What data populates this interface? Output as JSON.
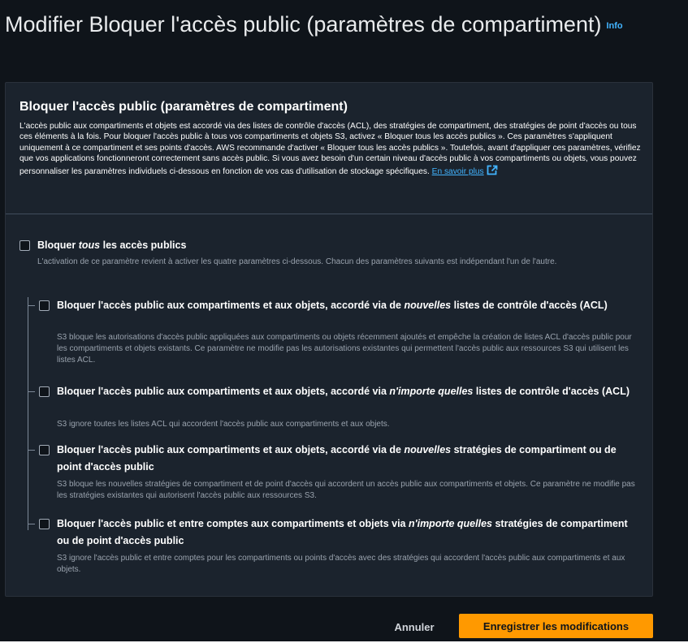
{
  "header": {
    "title": "Modifier Bloquer l'accès public (paramètres de compartiment)",
    "info_label": "Info"
  },
  "panel": {
    "title": "Bloquer l'accès public (paramètres de compartiment)",
    "description": "L'accès public aux compartiments et objets est accordé via des listes de contrôle d'accès (ACL), des stratégies de compartiment, des stratégies de point d'accès ou tous ces éléments à la fois. Pour bloquer l'accès public à tous vos compartiments et objets S3, activez « Bloquer tous les accès publics ». Ces paramètres s'appliquent uniquement à ce compartiment et ses points d'accès. AWS recommande d'activer « Bloquer tous les accès publics ». Toutefois, avant d'appliquer ces paramètres, vérifiez que vos applications fonctionneront correctement sans accès public. Si vous avez besoin d'un certain niveau d'accès public à vos compartiments ou objets, vous pouvez personnaliser les paramètres individuels ci-dessous en fonction de vos cas d'utilisation de stockage spécifiques.",
    "learn_more": "En savoir plus",
    "external_icon": "external-link-icon"
  },
  "block_all": {
    "title_prefix": "Bloquer",
    "title_emphasis": "tous",
    "title_suffix": "les accès publics",
    "description": "L'activation de ce paramètre revient à activer les quatre paramètres ci-dessous. Chacun des paramètres suivants est indépendant l'un de l'autre.",
    "checked": false
  },
  "options": [
    {
      "title_prefix": "Bloquer l'accès public aux compartiments et aux objets, accordé via de",
      "title_emphasis": "nouvelles",
      "title_suffix": "listes de contrôle d'accès (ACL)",
      "description": "S3 bloque les autorisations d'accès public appliquées aux compartiments ou objets récemment ajoutés et empêche la création de listes ACL d'accès public pour les compartiments et objets existants. Ce paramètre ne modifie pas les autorisations existantes qui permettent l'accès public aux ressources S3 qui utilisent les listes ACL.",
      "checked": false
    },
    {
      "title_prefix": "Bloquer l'accès public aux compartiments et aux objets, accordé via",
      "title_emphasis": "n'importe quelles",
      "title_suffix": "listes de contrôle d'accès (ACL)",
      "description": "S3 ignore toutes les listes ACL qui accordent l'accès public aux compartiments et aux objets.",
      "checked": false
    },
    {
      "title_prefix": "Bloquer l'accès public aux compartiments et aux objets, accordé via de",
      "title_emphasis": "nouvelles",
      "title_suffix": "stratégies de compartiment ou de point d'accès public",
      "description": "S3 bloque les nouvelles stratégies de compartiment et de point d'accès qui accordent un accès public aux compartiments et objets. Ce paramètre ne modifie pas les stratégies existantes qui autorisent l'accès public aux ressources S3.",
      "checked": false
    },
    {
      "title_prefix": "Bloquer l'accès public et entre comptes aux compartiments et objets via",
      "title_emphasis": "n'importe quelles",
      "title_suffix": "stratégies de compartiment ou de point d'accès public",
      "description": "S3 ignore l'accès public et entre comptes pour les compartiments ou points d'accès avec des stratégies qui accordent l'accès public aux compartiments et aux objets.",
      "checked": false
    }
  ],
  "footer": {
    "cancel_label": "Annuler",
    "save_label": "Enregistrer les modifications"
  },
  "colors": {
    "accent": "#ff9900",
    "link": "#42b4ff",
    "background": "#0f141a",
    "panel": "#1b232d"
  }
}
